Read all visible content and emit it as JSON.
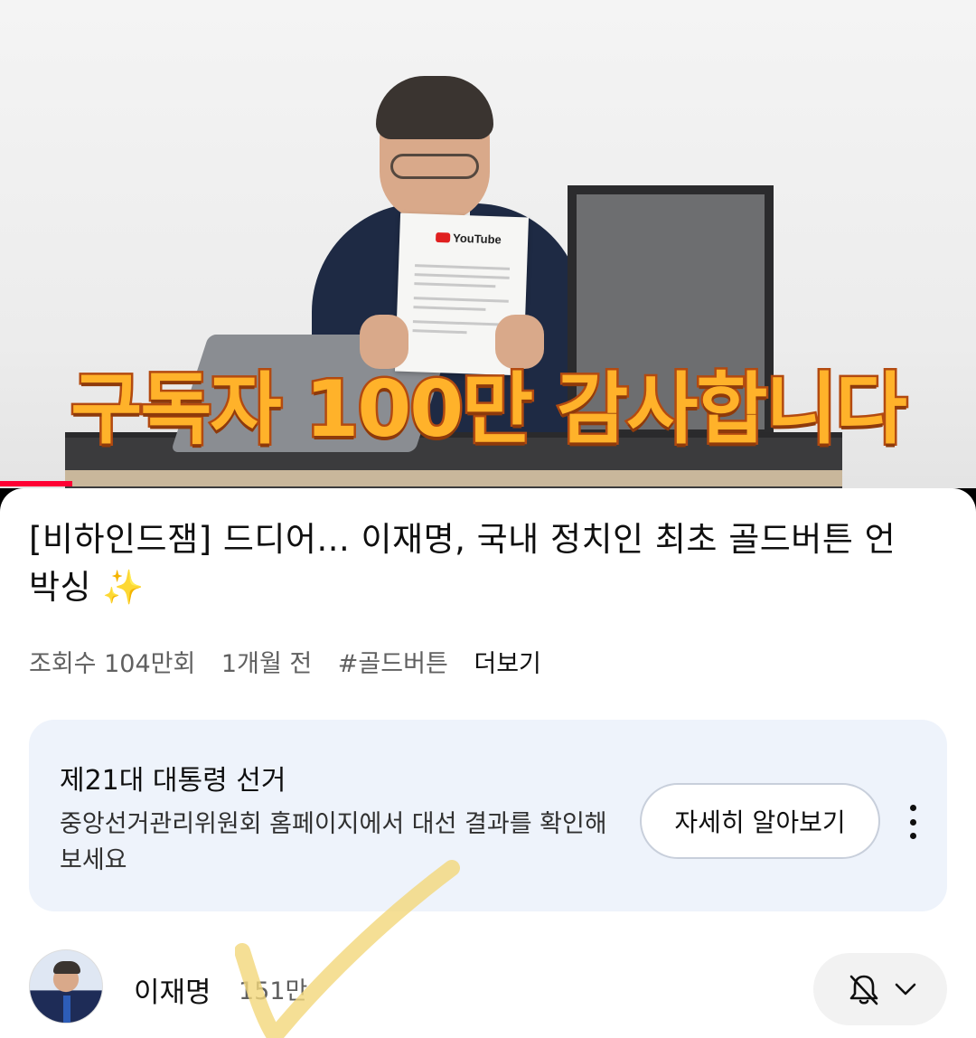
{
  "video": {
    "overlay_text": "구독자 100만 감사합니다",
    "paper_logo": "YouTube",
    "progress_fraction": 0.074,
    "progress_color": "#ff0033"
  },
  "title": "[비하인드잼] 드디어... 이재명, 국내 정치인 최초 골드버튼 언박싱 ✨",
  "meta": {
    "views": "조회수 104만회",
    "age": "1개월 전",
    "hashtag": "#골드버튼",
    "more": "더보기"
  },
  "info_card": {
    "title": "제21대 대통령 선거",
    "description": "중앙선거관리위원회 홈페이지에서 대선 결과를 확인해 보세요",
    "button_label": "자세히 알아보기",
    "menu_icon": "kebab-menu-icon",
    "background": "#eef3fb"
  },
  "channel": {
    "name": "이재명",
    "subscribers": "151만",
    "bell_icon": "bell-off-icon",
    "chevron_icon": "chevron-down-icon",
    "annotation": "yellow-checkmark"
  }
}
